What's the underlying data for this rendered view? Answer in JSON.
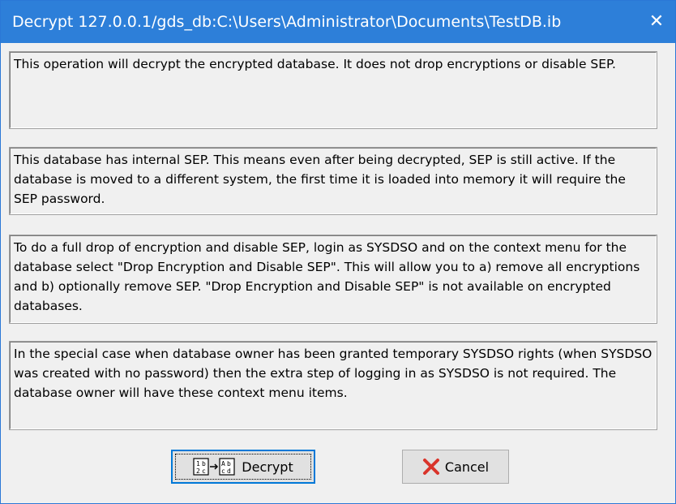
{
  "window": {
    "title": "Decrypt 127.0.0.1/gds_db:C:\\Users\\Administrator\\Documents\\TestDB.ib",
    "close_glyph": "✕"
  },
  "messages": [
    "This operation will decrypt the encrypted database.  It does not drop encryptions or disable SEP.",
    "This database has internal SEP.  This means even after being decrypted, SEP is still active.  If the database is moved to a different system, the first time it is loaded into memory it will require the SEP password.",
    "To do a full drop of encryption and disable SEP, login as SYSDSO and on the context menu for the database select \"Drop Encryption and Disable SEP\".  This will allow you to a) remove all encryptions and b) optionally remove SEP.  \"Drop Encryption and Disable SEP\" is not available on encrypted databases.",
    "In the special case when database owner has been granted temporary SYSDSO rights (when SYSDSO was created with no password) then the extra step of logging in as SYSDSO is not required.  The database owner will have these context menu items."
  ],
  "buttons": {
    "decrypt": {
      "label": "Decrypt",
      "icon": "decrypt-transform-icon"
    },
    "cancel": {
      "label": "Cancel",
      "icon": "red-x-icon"
    }
  },
  "colors": {
    "titlebar": "#2d7fd9",
    "dialog_bg": "#f0f0f0",
    "cancel_icon": "#d9342b",
    "focus_border": "#0078d7"
  }
}
